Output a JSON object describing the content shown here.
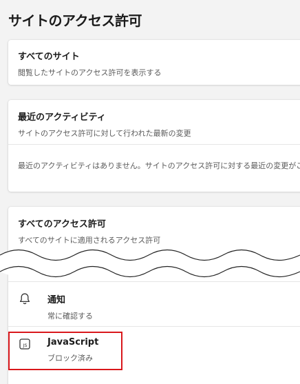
{
  "page": {
    "title": "サイトのアクセス許可"
  },
  "all_sites": {
    "title": "すべてのサイト",
    "subtitle": "閲覧したサイトのアクセス許可を表示する"
  },
  "recent_activity": {
    "title": "最近のアクティビティ",
    "subtitle": "サイトのアクセス許可に対して行われた最新の変更",
    "empty_message": "最近のアクティビティはありません。サイトのアクセス許可に対する最近の変更がここに表示されます"
  },
  "all_permissions": {
    "title": "すべてのアクセス許可",
    "subtitle": "すべてのサイトに適用されるアクセス許可",
    "items": [
      {
        "label": "通知",
        "status": "常に確認する",
        "icon": "bell-icon"
      },
      {
        "label": "JavaScript",
        "status": "ブロック済み",
        "icon": "javascript-icon"
      }
    ]
  },
  "colors": {
    "highlight": "#d9171b",
    "background": "#f3f3f3",
    "card": "#ffffff"
  }
}
